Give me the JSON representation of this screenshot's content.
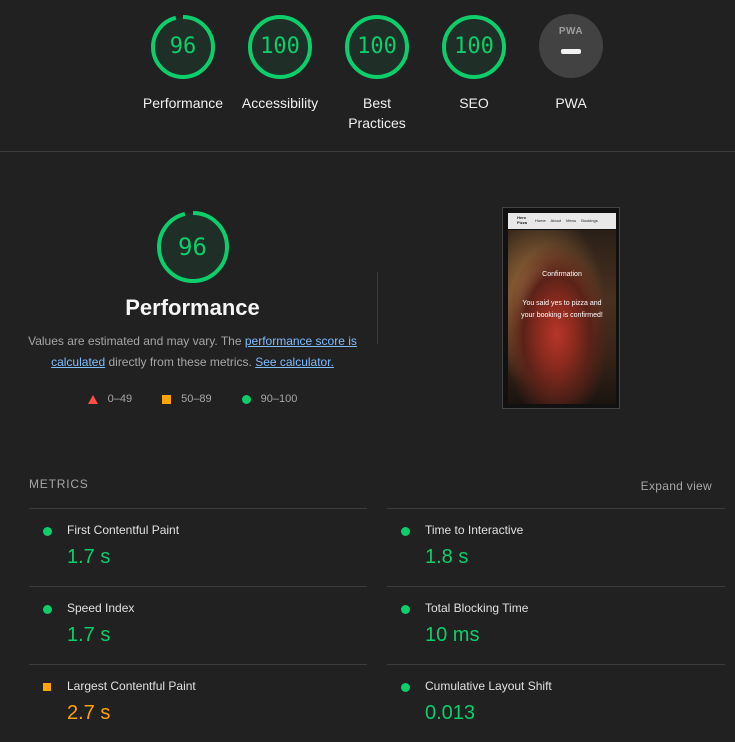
{
  "categories": [
    {
      "score": "96",
      "label": "Performance",
      "fraction": 0.96
    },
    {
      "score": "100",
      "label": "Accessibility",
      "fraction": 1.0
    },
    {
      "score": "100",
      "label": "Best Practices",
      "fraction": 1.0
    },
    {
      "score": "100",
      "label": "SEO",
      "fraction": 1.0
    }
  ],
  "pwa": {
    "label": "PWA",
    "badge_text": "PWA"
  },
  "performance": {
    "score": "96",
    "fraction": 0.96,
    "title": "Performance",
    "desc_prefix": "Values are estimated and may vary. The ",
    "desc_link1": "performance score is calculated",
    "desc_middle": " directly from these metrics. ",
    "desc_link2": "See calculator."
  },
  "legend": {
    "fail": "0–49",
    "average": "50–89",
    "pass": "90–100"
  },
  "screenshot": {
    "brand": "Hero Pizza",
    "nav_links": "Home About Menu Bookings",
    "title": "Confirmation",
    "message": "You said yes to pizza and your booking is confirmed!"
  },
  "metrics_header": "METRICS",
  "expand_view": "Expand view",
  "metrics": [
    {
      "name": "First Contentful Paint",
      "value": "1.7 s",
      "status": "pass"
    },
    {
      "name": "Time to Interactive",
      "value": "1.8 s",
      "status": "pass"
    },
    {
      "name": "Speed Index",
      "value": "1.7 s",
      "status": "pass"
    },
    {
      "name": "Total Blocking Time",
      "value": "10 ms",
      "status": "pass"
    },
    {
      "name": "Largest Contentful Paint",
      "value": "2.7 s",
      "status": "average"
    },
    {
      "name": "Cumulative Layout Shift",
      "value": "0.013",
      "status": "pass"
    }
  ],
  "colors": {
    "pass": "#0cce6b",
    "average": "#ffa400",
    "fail": "#ff4e42",
    "background": "#212121",
    "link": "#80bdff"
  }
}
